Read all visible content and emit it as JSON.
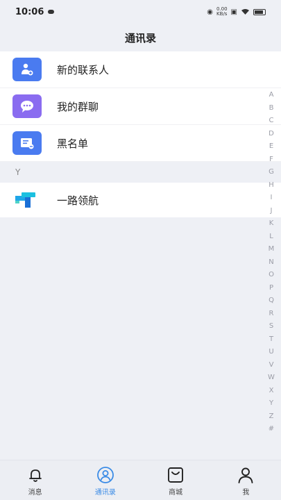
{
  "status": {
    "time": "10:06",
    "net_speed_value": "0.00",
    "net_speed_unit": "KB/s"
  },
  "header": {
    "title": "通讯录"
  },
  "rows": [
    {
      "label": "新的联系人",
      "icon": "new-contact-icon",
      "color": "#4a7bf0"
    },
    {
      "label": "我的群聊",
      "icon": "group-chat-icon",
      "color": "#8a6cf0"
    },
    {
      "label": "黑名单",
      "icon": "blacklist-icon",
      "color": "#4a7bf0"
    }
  ],
  "section": {
    "letter": "Y"
  },
  "contacts": [
    {
      "name": "一路领航",
      "icon": "yilu-logo"
    }
  ],
  "index_letters": [
    "A",
    "B",
    "C",
    "D",
    "E",
    "F",
    "G",
    "H",
    "I",
    "J",
    "K",
    "L",
    "M",
    "N",
    "O",
    "P",
    "Q",
    "R",
    "S",
    "T",
    "U",
    "V",
    "W",
    "X",
    "Y",
    "Z",
    "#"
  ],
  "tabs": [
    {
      "label": "消息",
      "icon": "bell-icon",
      "active": false
    },
    {
      "label": "通讯录",
      "icon": "contacts-icon",
      "active": true
    },
    {
      "label": "商城",
      "icon": "shopping-bag-icon",
      "active": false
    },
    {
      "label": "我",
      "icon": "person-icon",
      "active": false
    }
  ],
  "colors": {
    "accent": "#3a8be6",
    "background": "#eef0f5"
  }
}
